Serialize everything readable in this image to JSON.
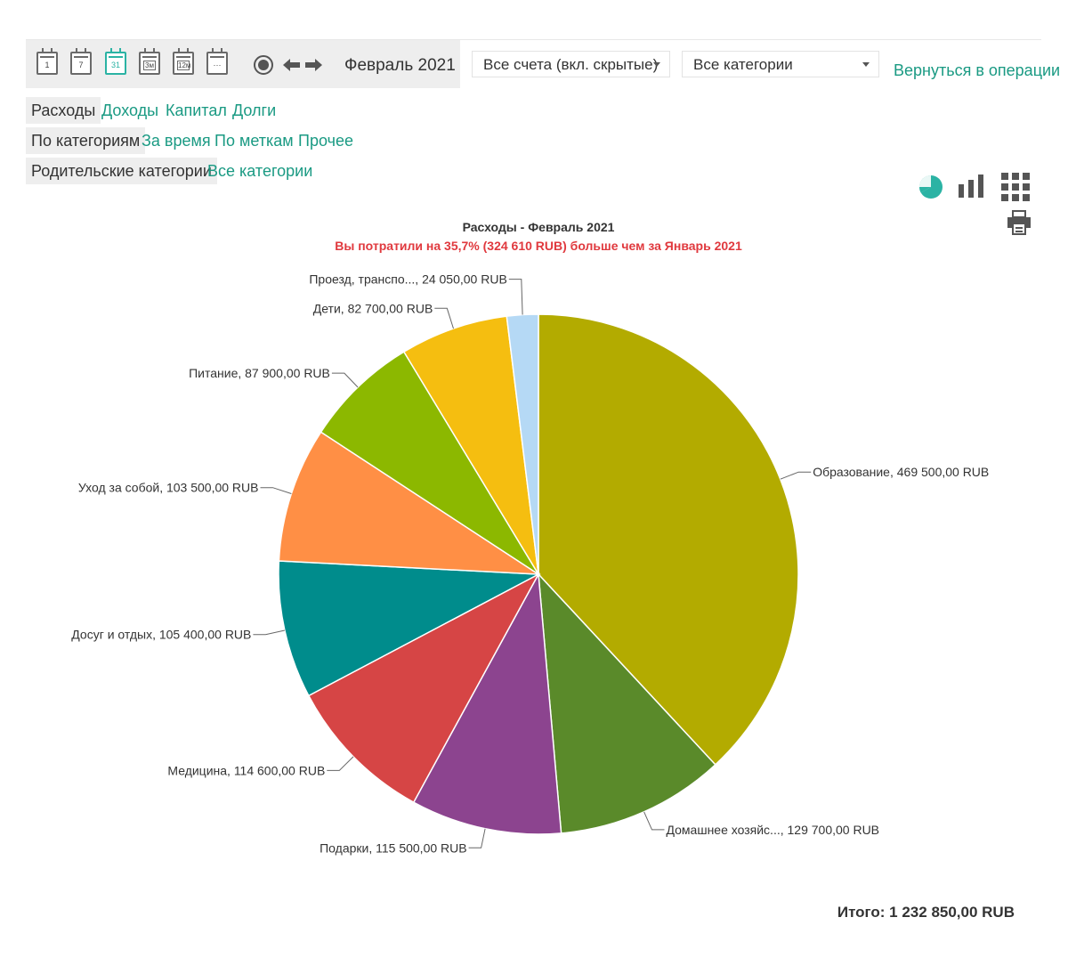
{
  "toolbar": {
    "period_buttons": [
      {
        "label": "1",
        "icon": "calendar-day-icon",
        "active": false
      },
      {
        "label": "7",
        "icon": "calendar-week-icon",
        "active": false
      },
      {
        "label": "31",
        "icon": "calendar-month-icon",
        "active": true
      },
      {
        "label": "3м",
        "icon": "calendar-quarter-icon",
        "active": false
      },
      {
        "label": "12м",
        "icon": "calendar-year-icon",
        "active": false
      },
      {
        "label": "···",
        "icon": "calendar-custom-icon",
        "active": false
      }
    ],
    "period": "Февраль 2021",
    "accounts_select": "Все счета (вкл. скрытые)",
    "categories_select": "Все категории",
    "back_link": "Вернуться в операции"
  },
  "nav": {
    "type_tabs": [
      {
        "label": "Расходы",
        "active": true
      },
      {
        "label": "Доходы",
        "active": false
      },
      {
        "label": "Капитал",
        "active": false
      },
      {
        "label": "Долги",
        "active": false
      }
    ],
    "grouping_tabs": [
      {
        "label": "По категориям",
        "active": true
      },
      {
        "label": "За время",
        "active": false
      },
      {
        "label": "По меткам",
        "active": false
      },
      {
        "label": "Прочее",
        "active": false
      }
    ],
    "category_tabs": [
      {
        "label": "Родительские категории",
        "active": true
      },
      {
        "label": "Все категории",
        "active": false
      }
    ]
  },
  "view_icons": [
    "pie-chart-icon",
    "bar-chart-icon",
    "grid-icon",
    "print-icon"
  ],
  "colors": {
    "accent": "#1a9a83",
    "active_icon": "#2bb3a4",
    "subtitle": "#e0393e"
  },
  "chart_data": {
    "type": "pie",
    "title": "Расходы - Февраль 2021",
    "subtitle": "Вы потратили на 35,7% (324 610 RUB) больше чем за Январь 2021",
    "slices": [
      {
        "label": "Образование, 469 500,00 RUB",
        "value": 469500,
        "color": "#b3ab00"
      },
      {
        "label": "Домашнее хозяйс..., 129 700,00 RUB",
        "value": 129700,
        "color": "#5a8a2a"
      },
      {
        "label": "Подарки, 115 500,00 RUB",
        "value": 115500,
        "color": "#8c448f"
      },
      {
        "label": "Медицина, 114 600,00 RUB",
        "value": 114600,
        "color": "#d64545"
      },
      {
        "label": "Досуг и отдых, 105 400,00 RUB",
        "value": 105400,
        "color": "#008c8c"
      },
      {
        "label": "Уход за собой, 103 500,00 RUB",
        "value": 103500,
        "color": "#ff8f45"
      },
      {
        "label": "Питание, 87 900,00 RUB",
        "value": 87900,
        "color": "#8cb800"
      },
      {
        "label": "Дети, 82 700,00 RUB",
        "value": 82700,
        "color": "#f5be10"
      },
      {
        "label": "Проезд, транспо..., 24 050,00 RUB",
        "value": 24050,
        "color": "#b5d9f5"
      }
    ],
    "total": "Итого: 1 232 850,00 RUB"
  }
}
